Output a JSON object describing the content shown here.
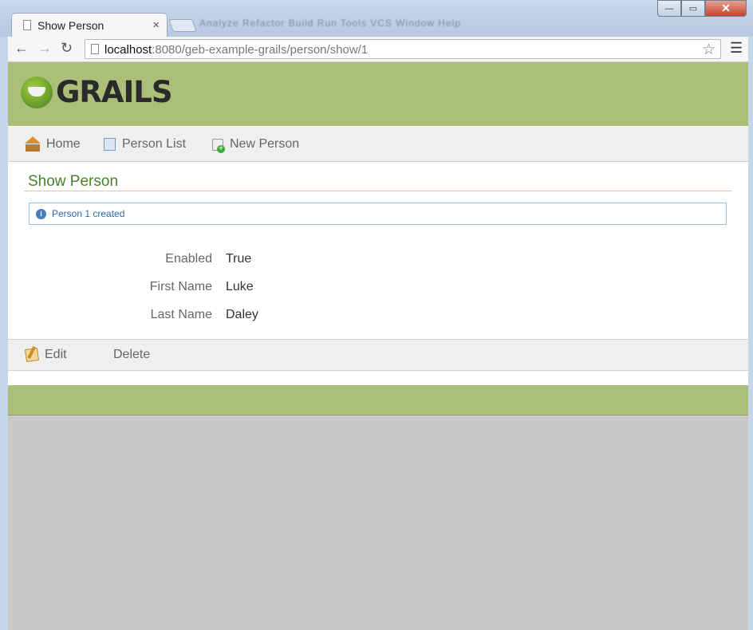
{
  "browser": {
    "tab_title": "Show Person",
    "tab_close": "×",
    "url_host": "localhost",
    "url_rest": ":8080/geb-example-grails/person/show/1",
    "blurred_menu_text": "Analyze   Refactor   Build   Run   Tools   VCS   Window   Help",
    "win_min": "—",
    "win_max": "▭",
    "win_close": "✕"
  },
  "header": {
    "logo_text": "GRAILS"
  },
  "nav": {
    "items": [
      {
        "label": "Home",
        "icon": "home-icon"
      },
      {
        "label": "Person List",
        "icon": "list-icon"
      },
      {
        "label": "New Person",
        "icon": "new-icon"
      }
    ]
  },
  "main": {
    "title": "Show Person",
    "message": "Person 1 created",
    "properties": [
      {
        "label": "Enabled",
        "value": "True"
      },
      {
        "label": "First Name",
        "value": "Luke"
      },
      {
        "label": "Last Name",
        "value": "Daley"
      }
    ]
  },
  "actions": {
    "edit_label": "Edit",
    "delete_label": "Delete"
  },
  "colors": {
    "header": "#abbf78",
    "title": "#48802c",
    "message_text": "#2c6aa8"
  }
}
